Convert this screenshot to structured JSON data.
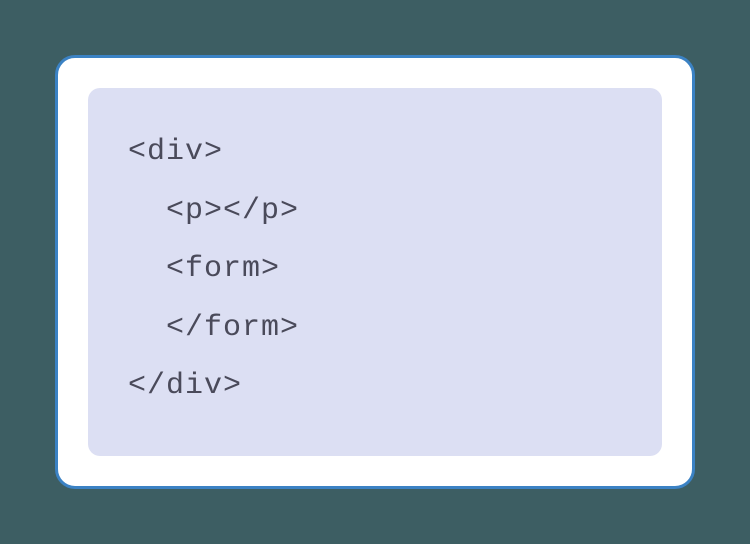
{
  "code": {
    "lines": [
      "<div>",
      "  <p></p>",
      "  <form>",
      "  </form>",
      "</div>"
    ]
  }
}
